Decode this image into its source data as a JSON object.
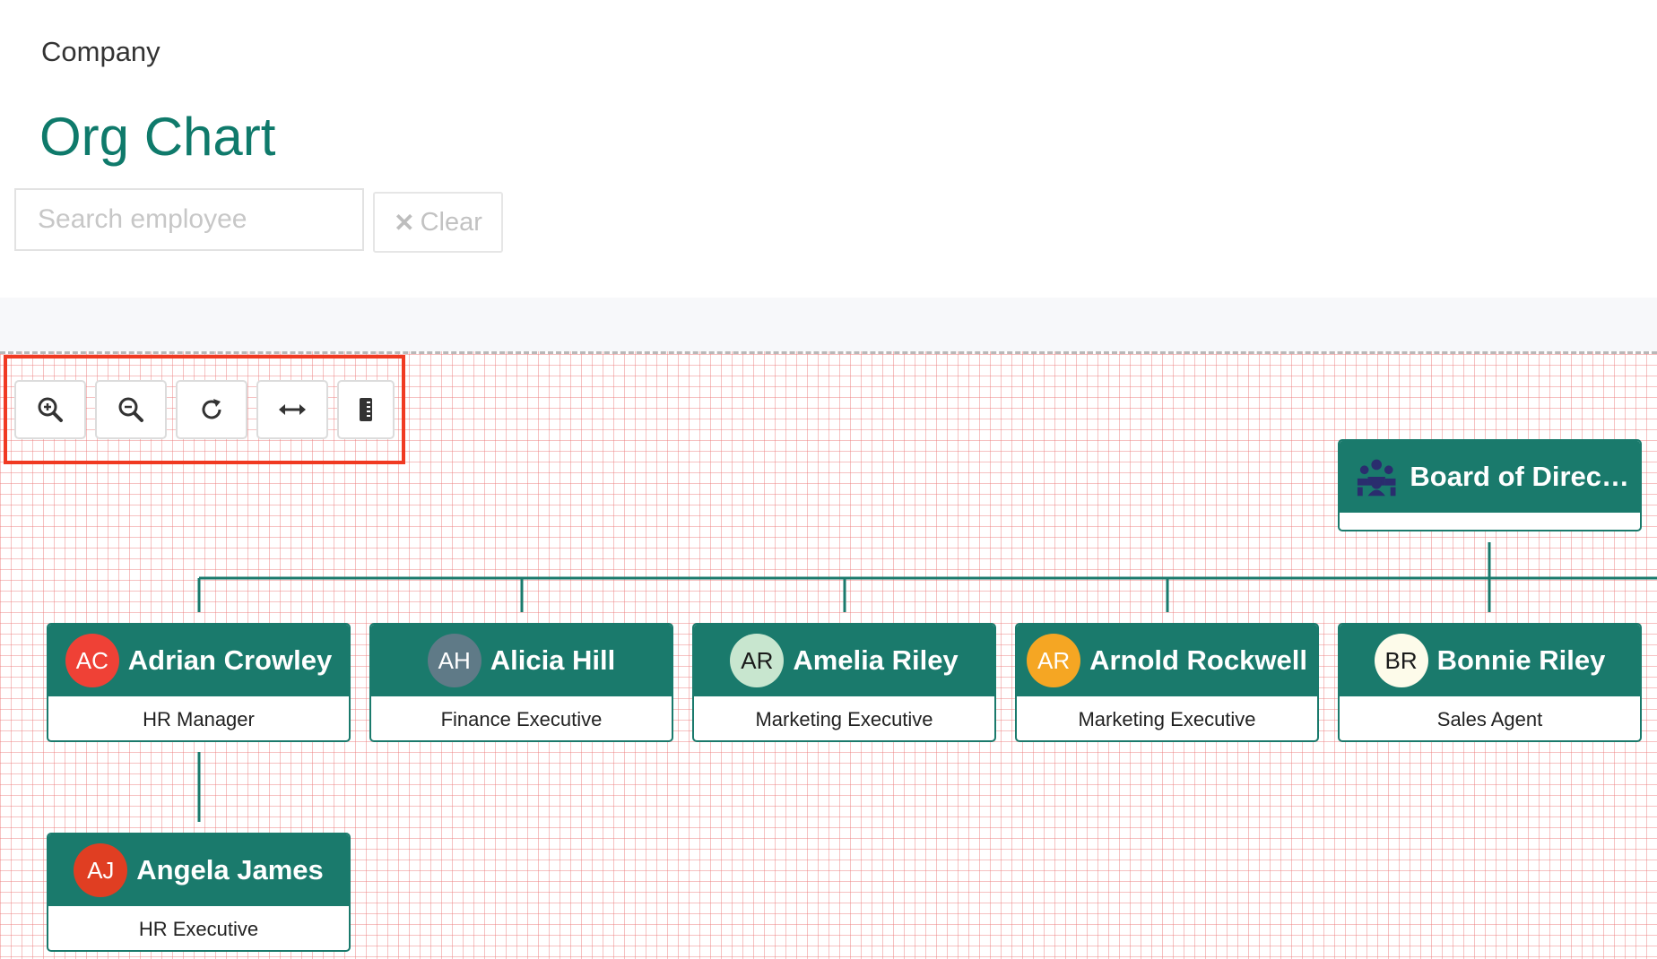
{
  "breadcrumb": "Company",
  "title": "Org Chart",
  "search": {
    "placeholder": "Search employee",
    "value": ""
  },
  "clear_button": {
    "icon": "close-icon",
    "label": "Clear"
  },
  "toolbar": [
    {
      "name": "zoom-in-button",
      "icon": "zoom-in-icon"
    },
    {
      "name": "zoom-out-button",
      "icon": "zoom-out-icon"
    },
    {
      "name": "reset-button",
      "icon": "refresh-icon"
    },
    {
      "name": "fit-width-button",
      "icon": "horizontal-arrows-icon"
    },
    {
      "name": "export-button",
      "icon": "document-icon"
    }
  ],
  "colors": {
    "brand": "#1a7a6c",
    "title": "#0f7a6b",
    "highlight": "#f03a22",
    "grid": "#ec7878",
    "board_icon": "#2a2d6e"
  },
  "board": {
    "name": "Board of Direct…",
    "icon": "team-icon"
  },
  "employees": [
    {
      "initials": "AC",
      "name": "Adrian Crowley",
      "role": "HR Manager",
      "avatar_color": "#ef4136",
      "initials_color": "#ffffff"
    },
    {
      "initials": "AH",
      "name": "Alicia Hill",
      "role": "Finance Executive",
      "avatar_color": "#5f7a87",
      "initials_color": "#ffffff"
    },
    {
      "initials": "AR",
      "name": "Amelia Riley",
      "role": "Marketing Executive",
      "avatar_color": "#c8e6cf",
      "initials_color": "#1a1a1a"
    },
    {
      "initials": "AR",
      "name": "Arnold Rockwell",
      "role": "Marketing Executive",
      "avatar_color": "#f5a623",
      "initials_color": "#ffffff"
    },
    {
      "initials": "BR",
      "name": "Bonnie Riley",
      "role": "Sales Agent",
      "avatar_color": "#fdfbea",
      "initials_color": "#1a1a1a"
    },
    {
      "initials": "AJ",
      "name": "Angela James",
      "role": "HR Executive",
      "avatar_color": "#e03e22",
      "initials_color": "#ffffff"
    }
  ]
}
